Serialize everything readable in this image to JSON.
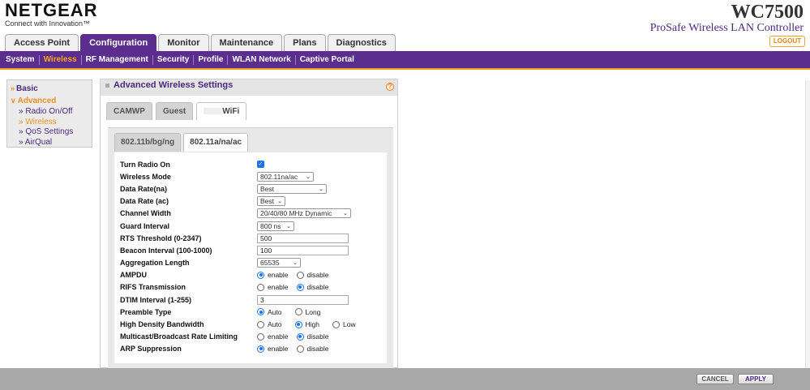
{
  "header": {
    "brand": "NETGEAR",
    "tagline": "Connect with Innovation™",
    "model": "WC7500",
    "product_desc": "ProSafe Wireless LAN Controller",
    "logout": "LOGOUT"
  },
  "main_tabs": [
    "Access Point",
    "Configuration",
    "Monitor",
    "Maintenance",
    "Plans",
    "Diagnostics"
  ],
  "sub_nav": [
    "System",
    "Wireless",
    "RF Management",
    "Security",
    "Profile",
    "WLAN Network",
    "Captive Portal"
  ],
  "left_menu": {
    "basic": "Basic",
    "advanced": "Advanced",
    "items": [
      "Radio On/Off",
      "Wireless",
      "QoS Settings",
      "AirQual"
    ]
  },
  "panel": {
    "title": "Advanced Wireless Settings",
    "help": "?",
    "ssid_tabs": [
      "CAMWP",
      "Guest",
      "WiFi"
    ],
    "band_tabs": [
      "802.11b/bg/ng",
      "802.11a/na/ac"
    ]
  },
  "settings": {
    "turn_radio_on": "Turn Radio On",
    "wireless_mode": {
      "label": "Wireless Mode",
      "value": "802.11na/ac"
    },
    "data_rate_na": {
      "label": "Data Rate(na)",
      "value": "Best"
    },
    "data_rate_ac": {
      "label": "Data Rate (ac)",
      "value": "Best"
    },
    "channel_width": {
      "label": "Channel Width",
      "value": "20/40/80 MHz Dynamic"
    },
    "guard_interval": {
      "label": "Guard Interval",
      "value": "800 ns"
    },
    "rts_threshold": {
      "label": "RTS Threshold (0-2347)",
      "value": "500"
    },
    "beacon_interval": {
      "label": "Beacon Interval (100-1000)",
      "value": "100"
    },
    "aggregation_length": {
      "label": "Aggregation Length",
      "value": "65535"
    },
    "ampdu": "AMPDU",
    "rifs": "RIFS Transmission",
    "dtim_interval": {
      "label": "DTIM Interval (1-255)",
      "value": "3"
    },
    "preamble": "Preamble Type",
    "high_density": "High Density Bandwidth",
    "multicast": "Multicast/Broadcast Rate Limiting",
    "arp": "ARP Suppression",
    "opt_enable": "enable",
    "opt_disable": "disable",
    "opt_auto": "Auto",
    "opt_long": "Long",
    "opt_high": "High",
    "opt_low": "Low"
  },
  "footer": {
    "cancel": "CANCEL",
    "apply": "APPLY"
  }
}
